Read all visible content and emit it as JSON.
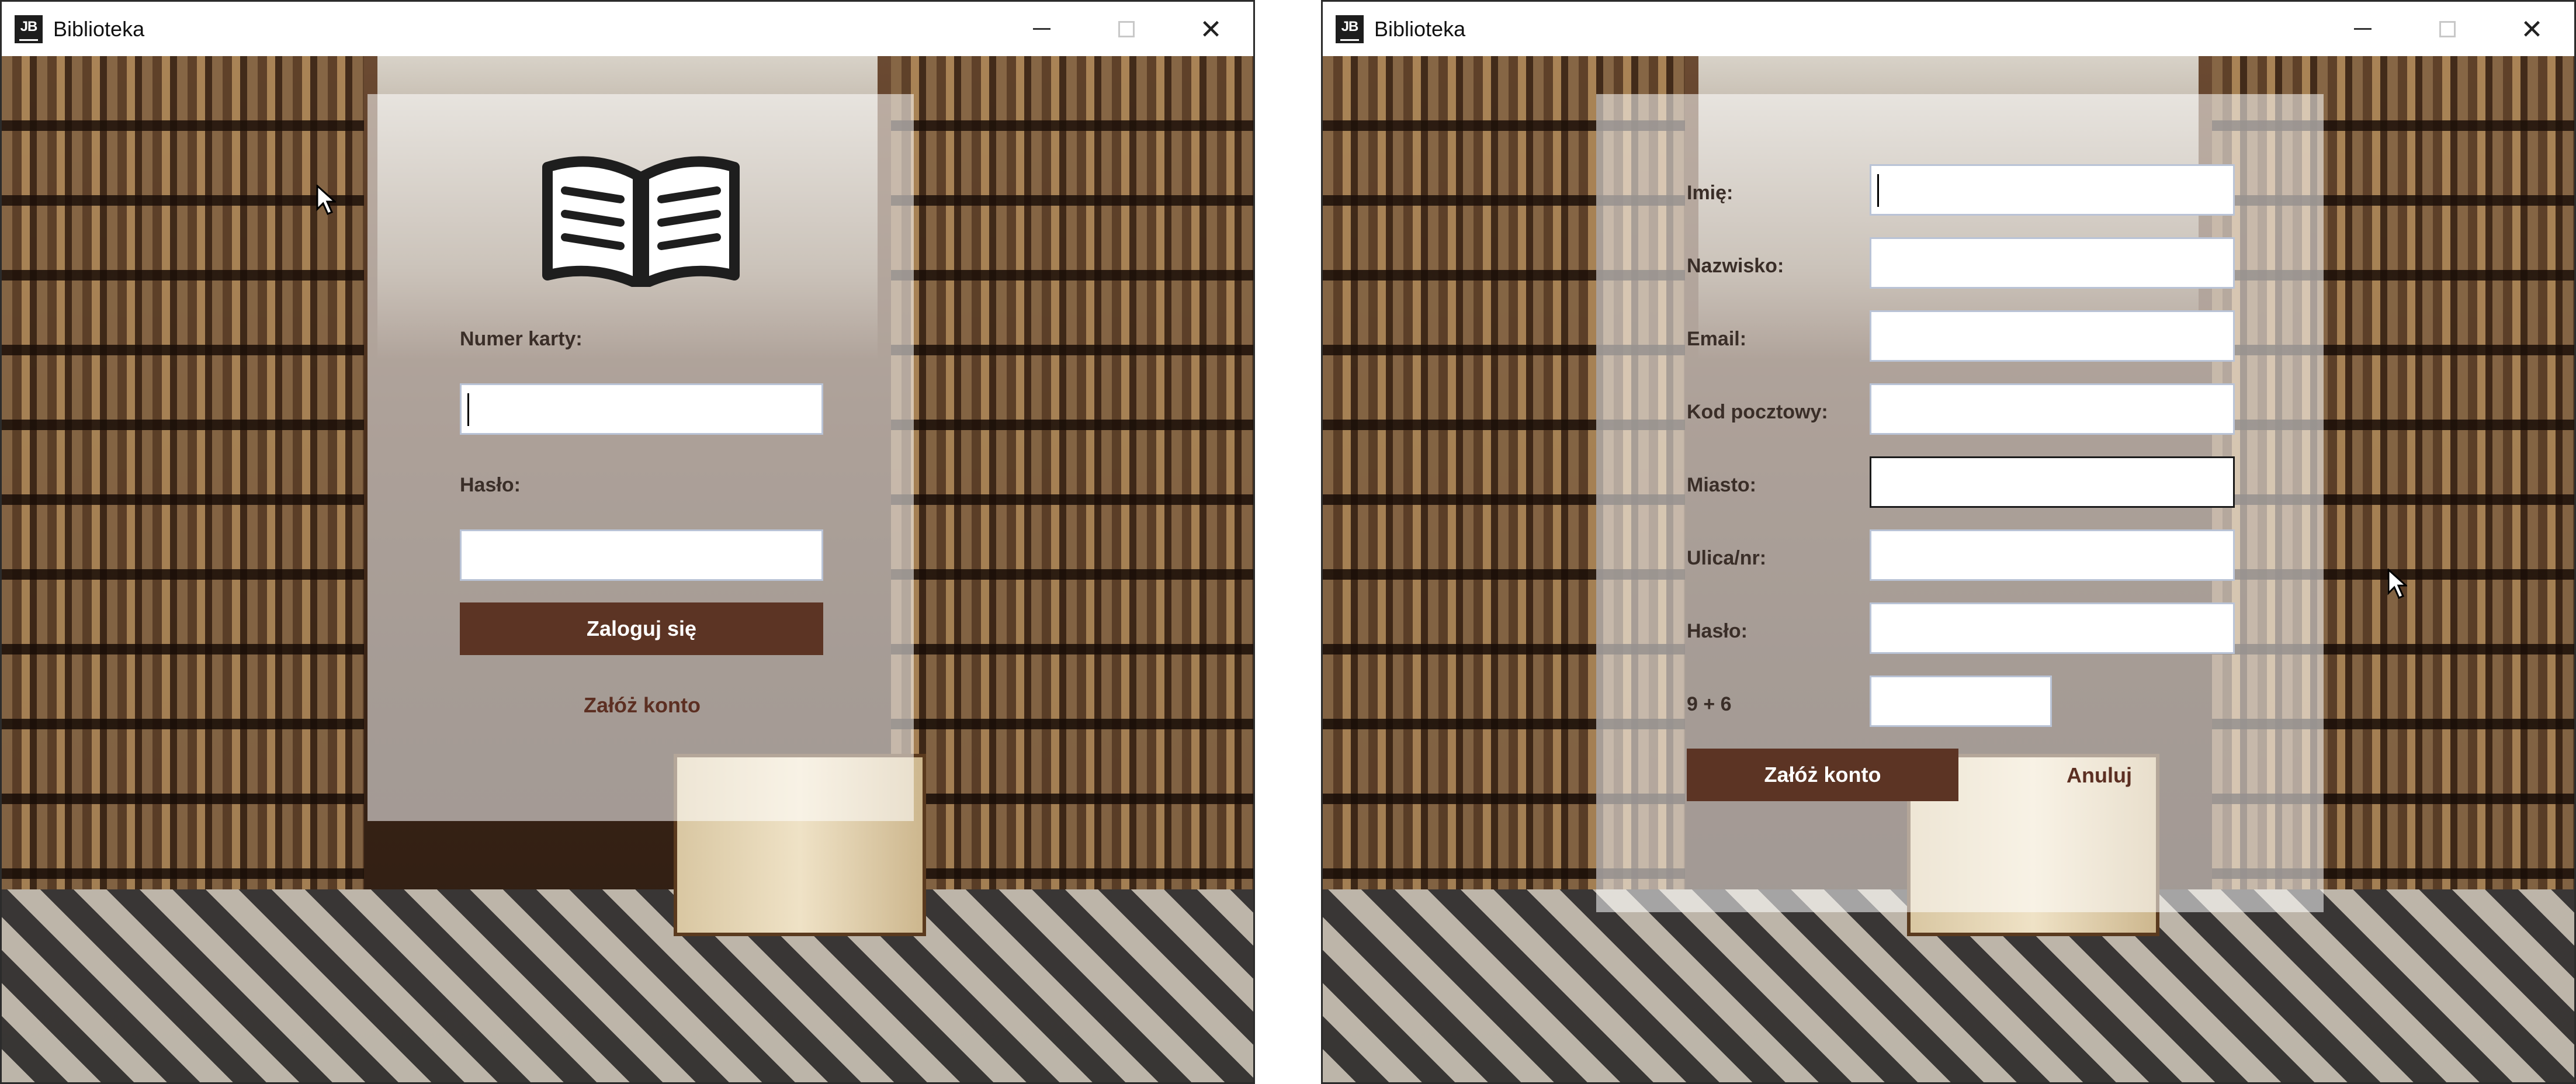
{
  "colors": {
    "accent": "#5c3424",
    "link": "#5c2f22",
    "label": "#3a2e28",
    "panel": "rgba(255,255,255,0.55)"
  },
  "login_window": {
    "title": "Biblioteka",
    "app_icon": "JB",
    "icons": [
      "book-icon"
    ],
    "card_label": "Numer karty:",
    "card_value": "",
    "password_label": "Hasło:",
    "password_value": "",
    "login_button": "Zaloguj się",
    "register_link": "Załóż konto"
  },
  "register_window": {
    "title": "Biblioteka",
    "app_icon": "JB",
    "fields": [
      {
        "label": "Imię:",
        "value": ""
      },
      {
        "label": "Nazwisko:",
        "value": ""
      },
      {
        "label": "Email:",
        "value": ""
      },
      {
        "label": "Kod pocztowy:",
        "value": ""
      },
      {
        "label": "Miasto:",
        "value": ""
      },
      {
        "label": "Ulica/nr:",
        "value": ""
      },
      {
        "label": "Hasło:",
        "value": ""
      }
    ],
    "captcha_label": "9 + 6",
    "captcha_value": "",
    "submit_button": "Załóż konto",
    "cancel_link": "Anuluj"
  }
}
